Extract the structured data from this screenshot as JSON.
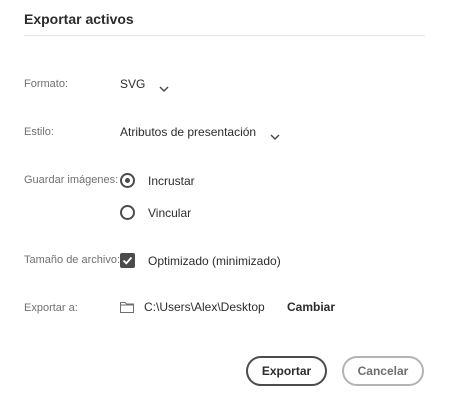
{
  "dialog": {
    "title": "Exportar activos"
  },
  "format": {
    "label": "Formato:",
    "value": "SVG",
    "icon": "chevron-down-icon"
  },
  "style": {
    "label": "Estilo:",
    "value": "Atributos de presentación",
    "icon": "chevron-down-icon"
  },
  "images": {
    "label": "Guardar imágenes:",
    "options": [
      {
        "label": "Incrustar",
        "selected": true
      },
      {
        "label": "Vincular",
        "selected": false
      }
    ]
  },
  "file_size": {
    "label": "Tamaño de archivo:",
    "option_label": "Optimizado (minimizado)",
    "checked": true
  },
  "export_to": {
    "label": "Exportar a:",
    "path": "C:\\Users\\Alex\\Desktop",
    "change_label": "Cambiar",
    "icon": "folder-icon"
  },
  "buttons": {
    "export": "Exportar",
    "cancel": "Cancelar"
  }
}
